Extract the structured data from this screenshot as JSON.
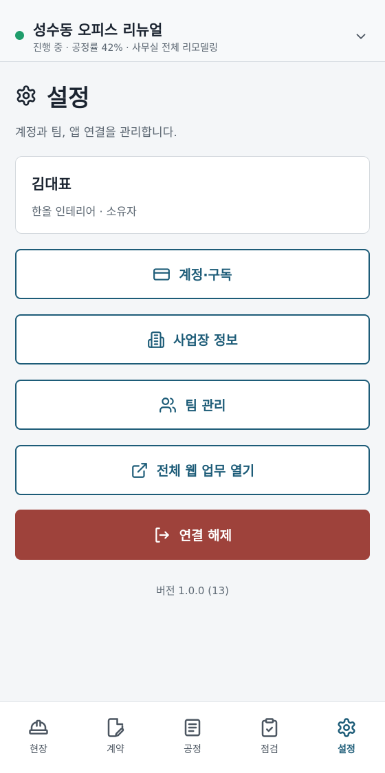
{
  "header": {
    "project_title": "성수동 오피스 리뉴얼",
    "project_subtitle": "진행 중 · 공정률 42% · 사무실 전체 리모델링",
    "status_color": "#1f9d6b"
  },
  "page": {
    "title": "설정",
    "description": "계정과 팀, 앱 연결을 관리합니다."
  },
  "profile": {
    "name": "김대표",
    "meta": "한올 인테리어 · 소유자"
  },
  "actions": [
    {
      "label": "계정·구독",
      "icon": "credit-card-icon"
    },
    {
      "label": "사업장 정보",
      "icon": "building-icon"
    },
    {
      "label": "팀 관리",
      "icon": "users-icon"
    },
    {
      "label": "전체 웹 업무 열기",
      "icon": "external-link-icon"
    }
  ],
  "logout": {
    "label": "연결 해제",
    "icon": "logout-icon",
    "color": "#9e423b"
  },
  "version": "버전 1.0.0 (13)",
  "tabs": [
    {
      "label": "현장",
      "icon": "hard-hat-icon",
      "active": false
    },
    {
      "label": "계약",
      "icon": "contract-edit-icon",
      "active": false
    },
    {
      "label": "공정",
      "icon": "document-list-icon",
      "active": false
    },
    {
      "label": "점검",
      "icon": "clipboard-check-icon",
      "active": false
    },
    {
      "label": "설정",
      "icon": "gear-icon",
      "active": true
    }
  ],
  "colors": {
    "accent": "#1d5c78",
    "danger": "#9e423b"
  }
}
